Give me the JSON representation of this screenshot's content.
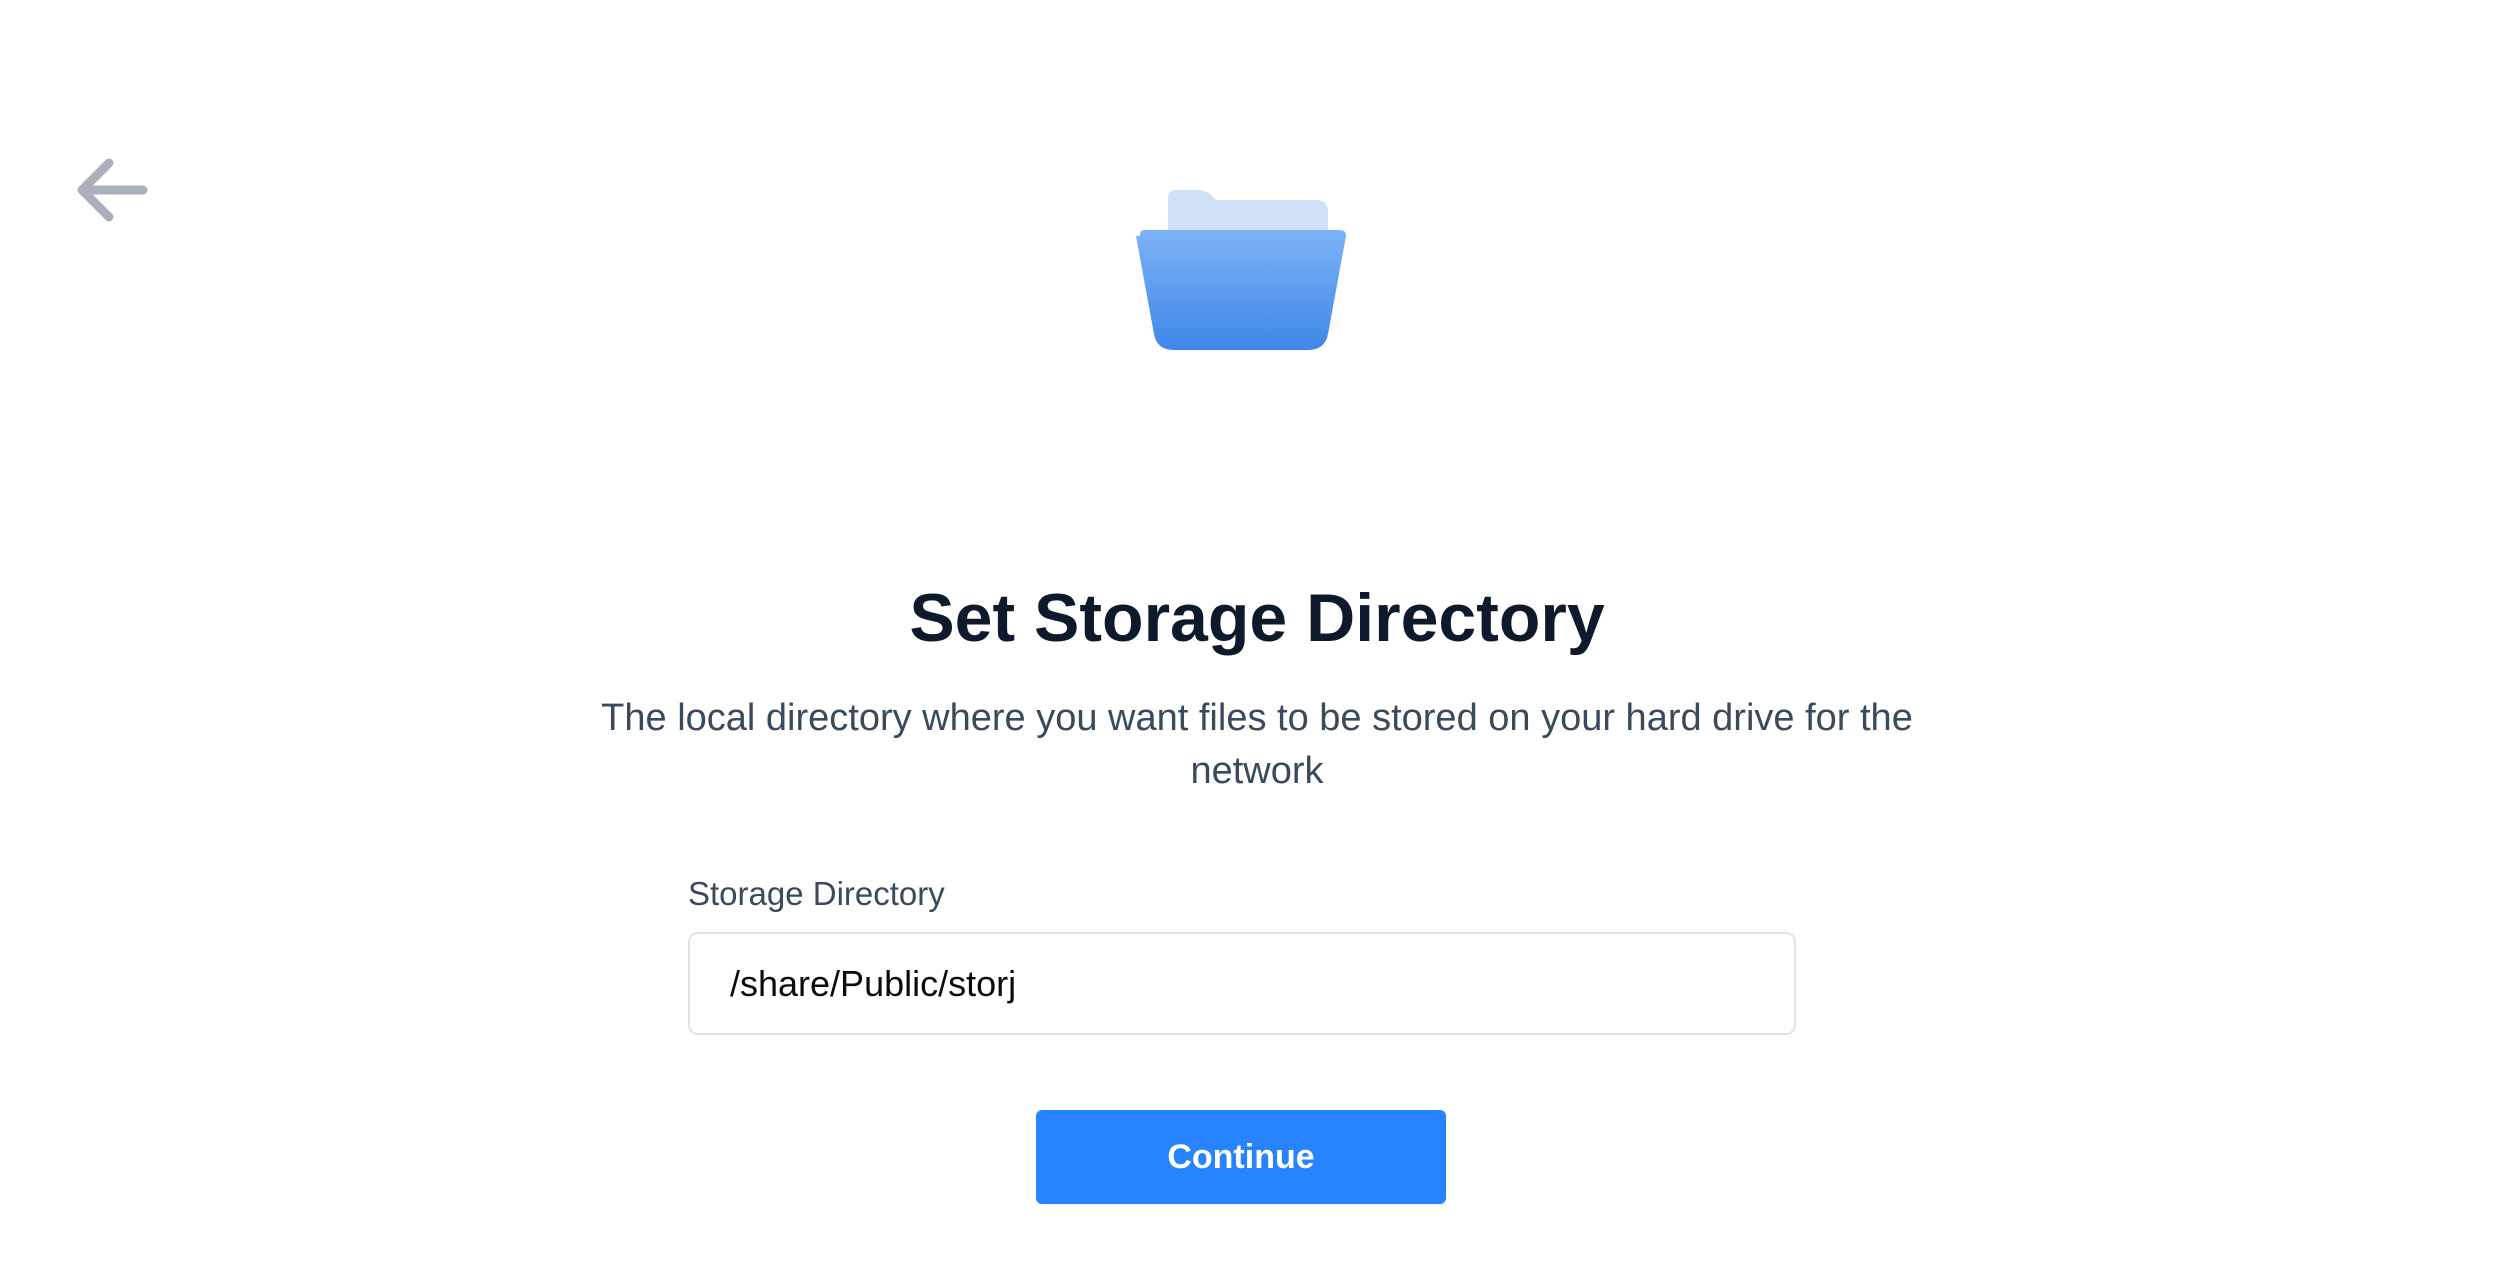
{
  "icons": {
    "back": "arrow-left-icon",
    "hero": "folder-open-icon"
  },
  "colors": {
    "accent": "#2783ff",
    "title": "#0e1a2b",
    "body_text": "#3a4a5e",
    "back_arrow": "#a9b0bc",
    "folder_front_top": "#7db2f7",
    "folder_front_bottom": "#3f87e9",
    "folder_back": "#cfe0f8"
  },
  "main": {
    "title": "Set Storage Directory",
    "description": "The local directory where you want files to be stored on your hard drive for the network",
    "storage_field": {
      "label": "Storage Directory",
      "value": "/share/Public/storj"
    },
    "continue_label": "Continue"
  }
}
